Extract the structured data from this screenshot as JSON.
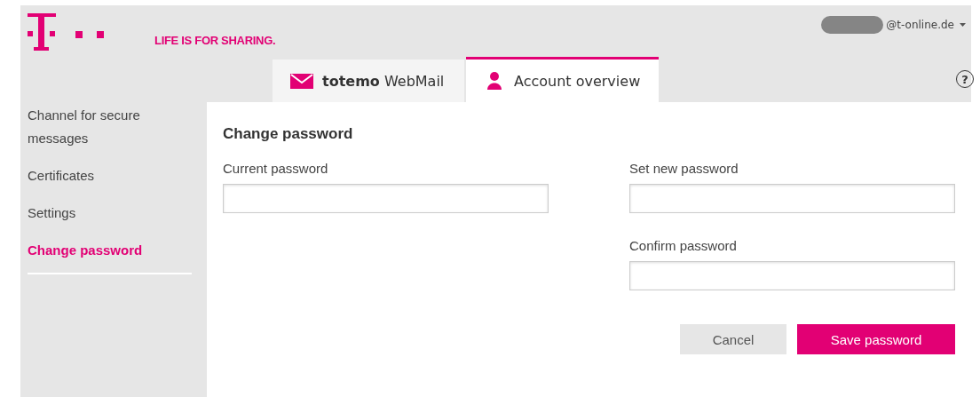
{
  "header": {
    "slogan": "LIFE IS FOR SHARING.",
    "account": "@t-online.de"
  },
  "tabs": [
    {
      "label": "**totemo** WebMail",
      "selected": false
    },
    {
      "label": "Account overview",
      "selected": true
    }
  ],
  "help": "?",
  "sidebar": {
    "items": [
      {
        "label": "Channel for secure messages",
        "selected": false
      },
      {
        "label": "Certificates",
        "selected": false
      },
      {
        "label": "Settings",
        "selected": false
      },
      {
        "label": "Change password",
        "selected": true
      }
    ]
  },
  "form": {
    "title": "Change password",
    "left_fields": [
      {
        "label": "Current password"
      }
    ],
    "right_fields": [
      {
        "label": "Set new password"
      },
      {
        "label": "Confirm password"
      }
    ],
    "buttons": [
      {
        "label": "Cancel",
        "kind": "secondary"
      },
      {
        "label": "Save password",
        "kind": "primary"
      }
    ]
  }
}
